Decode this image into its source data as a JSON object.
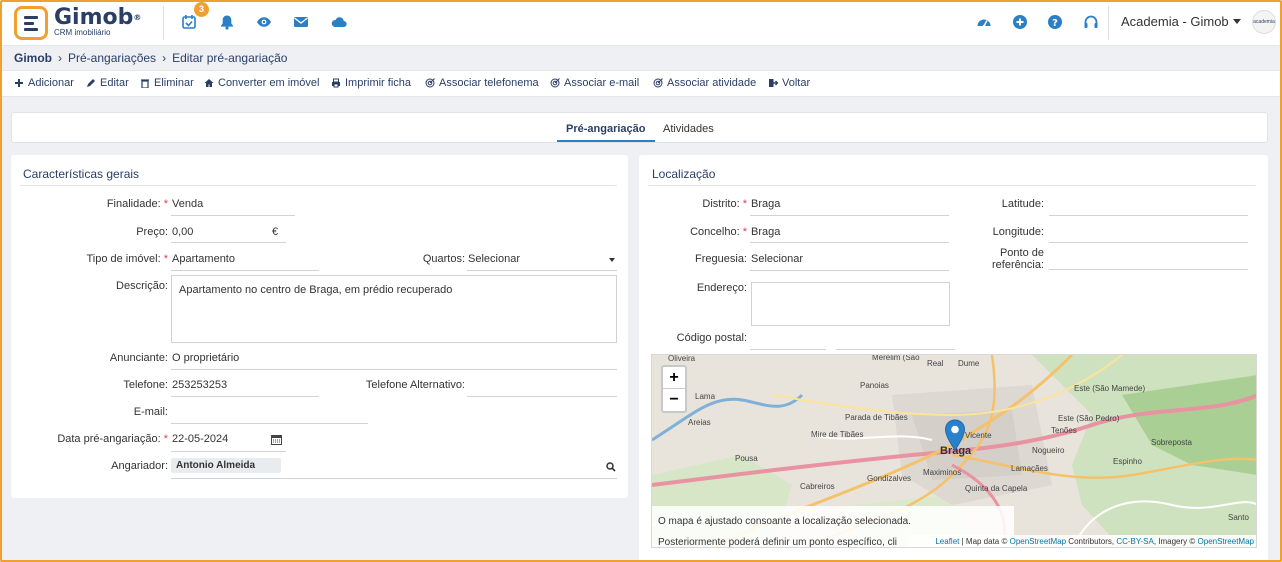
{
  "app": {
    "name": "Gimob",
    "reg": "®",
    "subtitle": "CRM imobiliário",
    "company": "Academia - Gimob",
    "avatar_text": "academia"
  },
  "topbar": {
    "tasks_badge": "3",
    "icons": [
      "tasks-icon",
      "bell-icon",
      "eye-icon",
      "mail-icon",
      "cloud-icon"
    ],
    "right_icons": [
      "dashboard-icon",
      "plus-circle-icon",
      "help-icon",
      "headset-icon"
    ]
  },
  "breadcrumb": {
    "root": "Gimob",
    "level1": "Pré-angariações",
    "level2": "Editar pré-angariação"
  },
  "toolbar": {
    "add": "Adicionar",
    "edit": "Editar",
    "delete": "Eliminar",
    "convert": "Converter em imóvel",
    "print": "Imprimir ficha",
    "phone": "Associar telefonema",
    "email": "Associar e-mail",
    "activity": "Associar atividade",
    "back": "Voltar"
  },
  "tabs": {
    "pre": "Pré-angariação",
    "activities": "Atividades"
  },
  "general": {
    "title": "Características gerais",
    "finalidade_label": "Finalidade:",
    "finalidade": "Venda",
    "preco_label": "Preço:",
    "preco": "0,00",
    "currency": "€",
    "tipo_label": "Tipo de imóvel:",
    "tipo": "Apartamento",
    "quartos_label": "Quartos:",
    "quartos": "Selecionar",
    "descricao_label": "Descrição:",
    "descricao": "Apartamento no centro de Braga, em prédio recuperado",
    "anunciante_label": "Anunciante:",
    "anunciante": "O proprietário",
    "telefone_label": "Telefone:",
    "telefone": "253253253",
    "telefone_alt_label": "Telefone Alternativo:",
    "telefone_alt": "",
    "email_label": "E-mail:",
    "email": "",
    "data_label": "Data pré-angariação:",
    "data": "22-05-2024",
    "angariador_label": "Angariador:",
    "angariador": "Antonio Almeida",
    "required_mark": "*"
  },
  "location": {
    "title": "Localização",
    "distrito_label": "Distrito:",
    "distrito": "Braga",
    "concelho_label": "Concelho:",
    "concelho": "Braga",
    "freguesia_label": "Freguesia:",
    "freguesia": "Selecionar",
    "endereco_label": "Endereço:",
    "endereco": "",
    "codigo_label": "Código postal:",
    "latitude_label": "Latitude:",
    "longitude_label": "Longitude:",
    "ponto_label_1": "Ponto de",
    "ponto_label_2": "referência:"
  },
  "map": {
    "zoom_in": "+",
    "zoom_out": "−",
    "note1": "O mapa é ajustado consoante a localização selecionada.",
    "note2": "Posteriormente poderá definir um ponto específico, cli",
    "attr_leaflet": "Leaflet",
    "attr_text1": " | Map data © ",
    "attr_osm": "OpenStreetMap",
    "attr_text2": " Contributors, ",
    "attr_cc": "CC-BY-SA",
    "attr_text3": ", Imagery © ",
    "attr_osm2": "OpenStreetMap",
    "places": {
      "oliveira": "Oliveira",
      "merelim": "Merelim (São",
      "real": "Real",
      "dume": "Dume",
      "sao_mamede": "Este (São Mamede)",
      "panoias": "Panoias",
      "lama": "Lama",
      "parada": "Parada de Tibães",
      "este_pedro": "Este (São Pedro)",
      "areias": "Areias",
      "mire": "Mire de Tibães",
      "vicente": "Vicente",
      "tenoes": "Tenões",
      "sobreposta": "Sobreposta",
      "pousa": "Pousa",
      "braga": "Braga",
      "nogueiro": "Nogueiro",
      "espinho": "Espinho",
      "maximinos": "Maximinos",
      "lamacaes": "Lamaçães",
      "gondizalves": "Gondizalves",
      "cabreiros": "Cabreiros",
      "quinta": "Quinta da Capela",
      "santo": "Santo"
    }
  }
}
